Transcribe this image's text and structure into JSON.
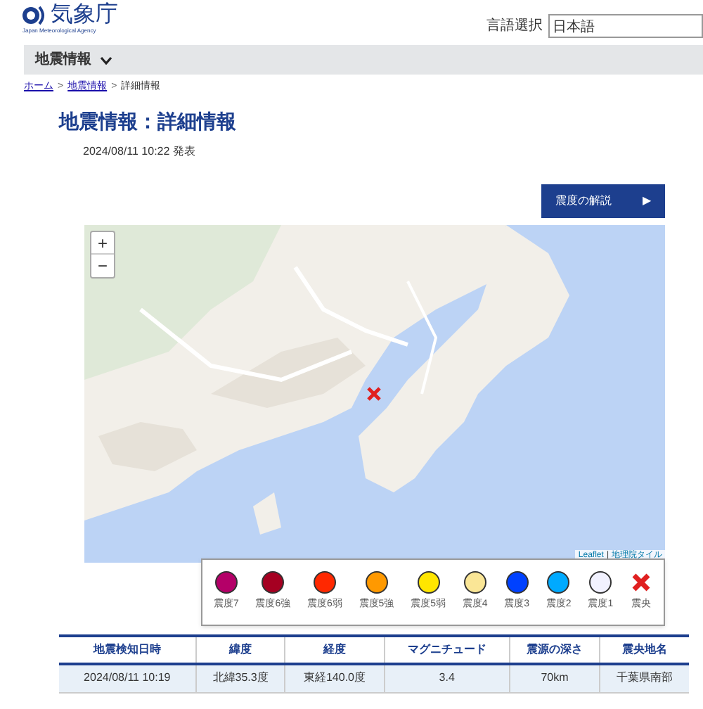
{
  "header": {
    "logo_text": "気象庁",
    "logo_subtext": "Japan Meteorological Agency",
    "language_label": "言語選択",
    "language_value": "日本語"
  },
  "nav": {
    "label": "地震情報"
  },
  "breadcrumb_separator": ">",
  "breadcrumb": [
    {
      "label": "ホーム",
      "kind": "link"
    },
    {
      "label": "地震情報",
      "kind": "link"
    },
    {
      "label": "詳細情報",
      "kind": "current"
    }
  ],
  "page_title": "地震情報：詳細情報",
  "issued": "2024/08/11 10:22 発表",
  "explain_button": {
    "label": "震度の解説",
    "icon": "▶"
  },
  "map": {
    "zoom_in": "+",
    "zoom_out": "−",
    "attribution_separator": "|",
    "attribution": [
      {
        "label": "Leaflet",
        "kind": "link"
      },
      {
        "label": "地理院タイル",
        "kind": "link"
      }
    ]
  },
  "legend": [
    {
      "label": "震度7",
      "kind": "dot",
      "color": "#b40068"
    },
    {
      "label": "震度6強",
      "kind": "dot",
      "color": "#a50021"
    },
    {
      "label": "震度6弱",
      "kind": "dot",
      "color": "#ff2800"
    },
    {
      "label": "震度5強",
      "kind": "dot",
      "color": "#ff9900"
    },
    {
      "label": "震度5弱",
      "kind": "dot",
      "color": "#ffe600"
    },
    {
      "label": "震度4",
      "kind": "dot",
      "color": "#fae696"
    },
    {
      "label": "震度3",
      "kind": "dot",
      "color": "#0041ff"
    },
    {
      "label": "震度2",
      "kind": "dot",
      "color": "#00aaff"
    },
    {
      "label": "震度1",
      "kind": "dot",
      "color": "#f2f2ff"
    },
    {
      "label": "震央",
      "kind": "cross",
      "color": "#e02020"
    }
  ],
  "table": {
    "columns": [
      "地震検知日時",
      "緯度",
      "経度",
      "マグニチュード",
      "震源の深さ",
      "震央地名"
    ],
    "rows": [
      [
        "2024/08/11 10:19",
        "北緯35.3度",
        "東経140.0度",
        "3.4",
        "70km",
        "千葉県南部"
      ]
    ]
  }
}
